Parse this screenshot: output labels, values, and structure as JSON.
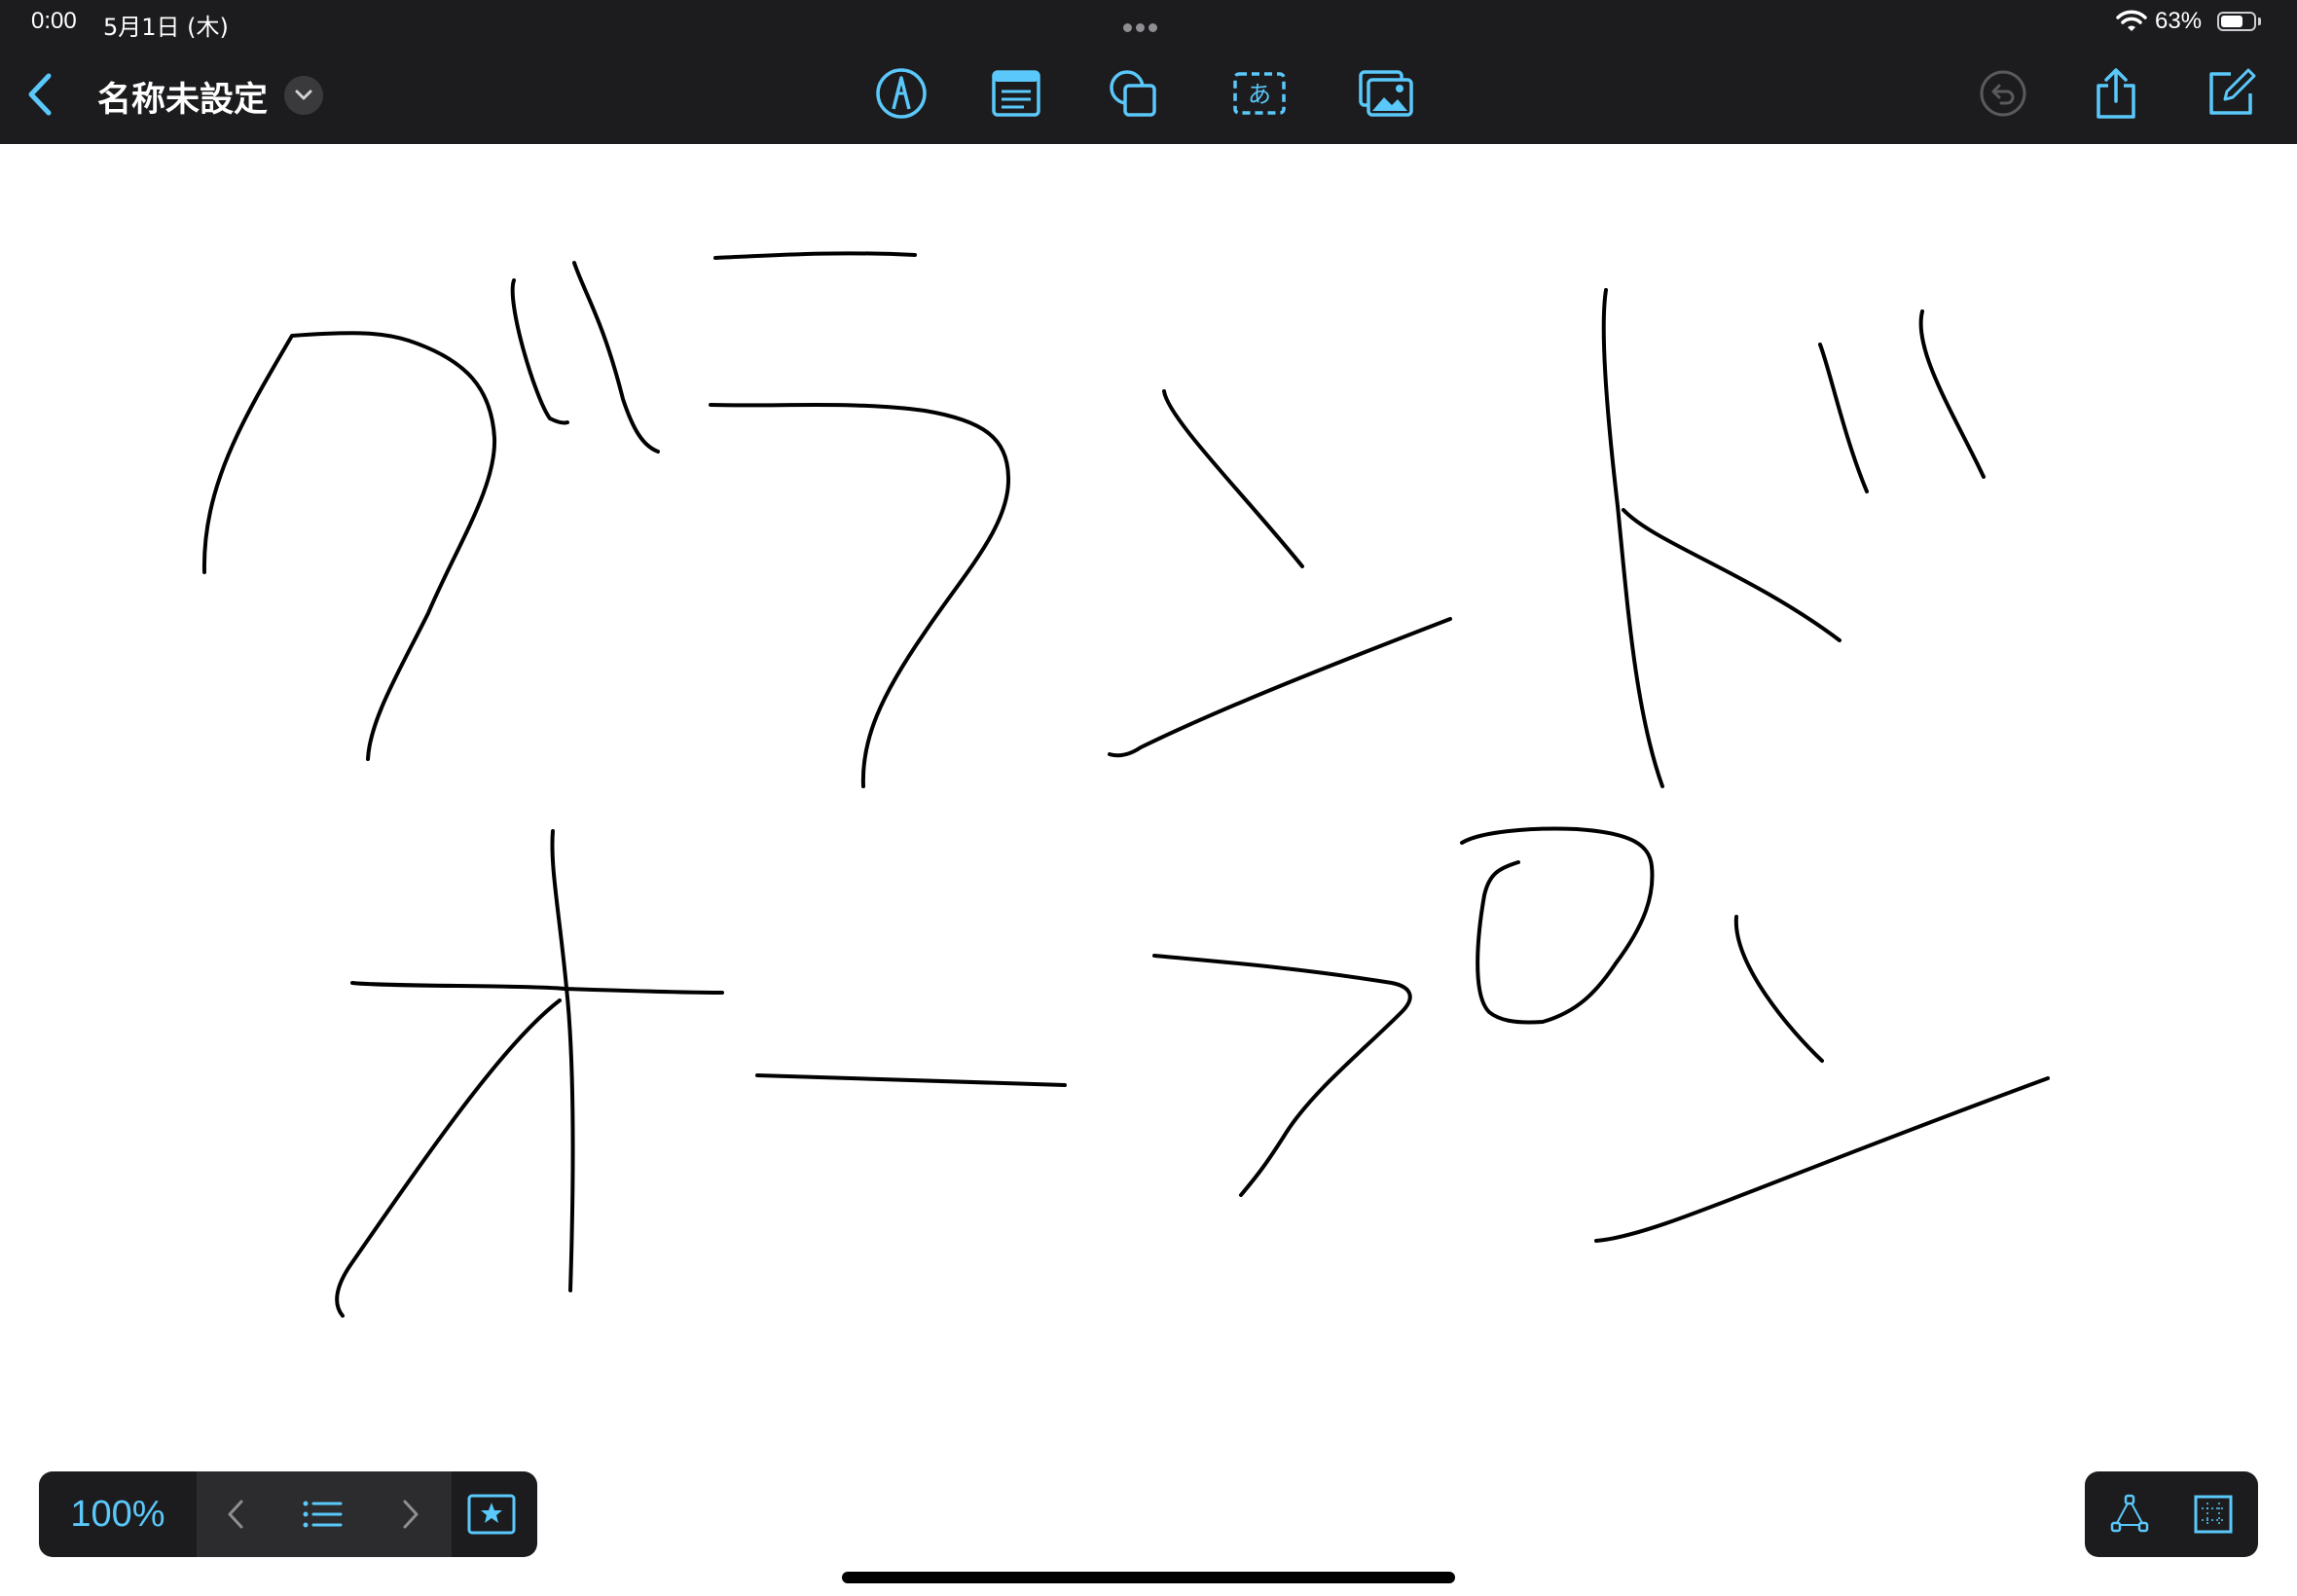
{
  "status_bar": {
    "time": "0:00",
    "date": "5月1日 (木)",
    "battery": "63%",
    "wifi_icon": "wifi-icon"
  },
  "toolbar": {
    "title": "名称未設定",
    "accent_color": "#5ac8fa",
    "icons": [
      "back-chevron-icon",
      "title-menu-chevron-icon",
      "pen-icon",
      "note-icon",
      "shapes-icon",
      "text-box-icon",
      "photos-icon",
      "undo-icon",
      "share-icon",
      "compose-icon"
    ]
  },
  "bottom_bar": {
    "zoom": "100%",
    "icons": [
      "prev-page-icon",
      "page-list-icon",
      "next-page-icon",
      "bookmark-star-icon",
      "lasso-icon",
      "selection-grid-icon"
    ]
  },
  "canvas": {
    "handwritten_lines": [
      "グランド",
      "オープン"
    ],
    "ink_color": "#000000"
  }
}
